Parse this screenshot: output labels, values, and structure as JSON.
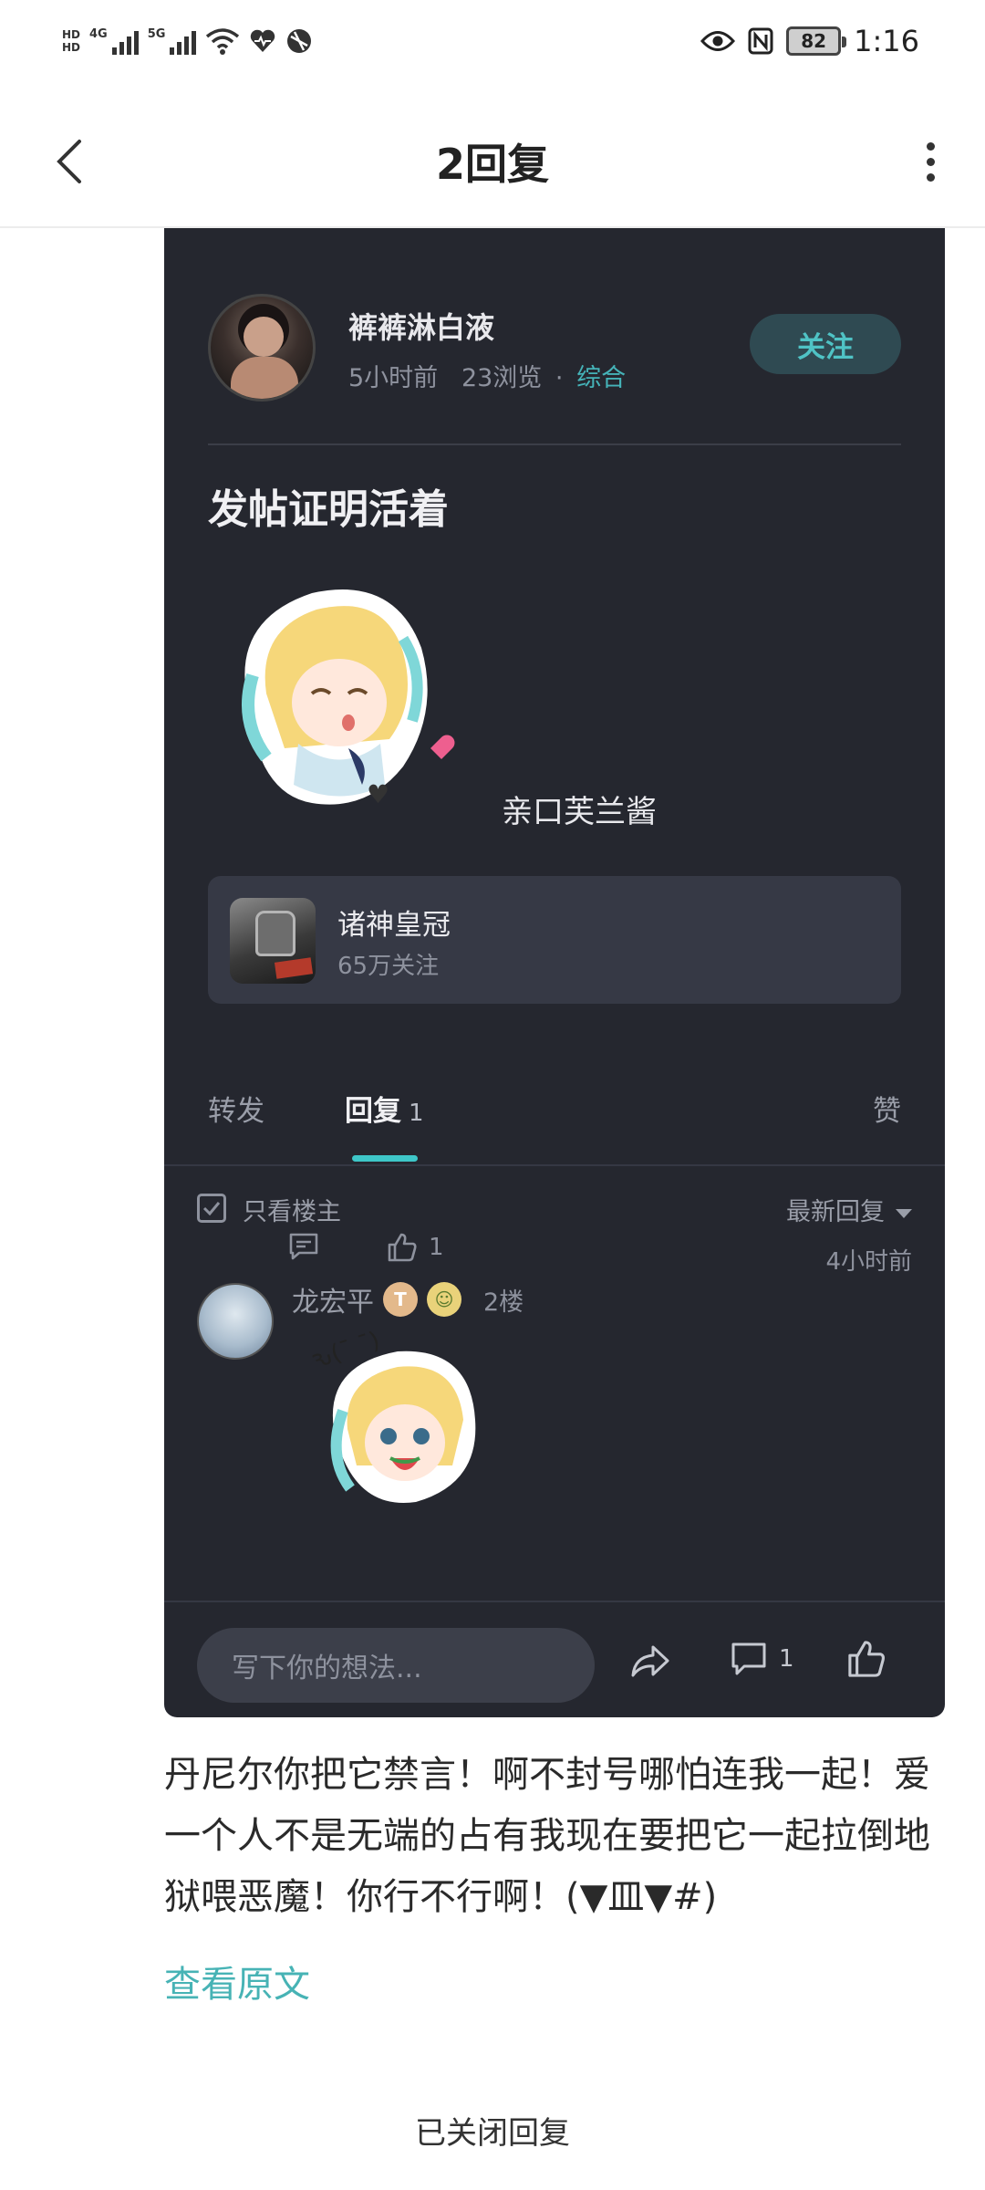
{
  "status_bar": {
    "hd1": "HD",
    "hd2": "HD",
    "net1": "4G",
    "net2": "5G",
    "battery": "82",
    "time": "1:16"
  },
  "header": {
    "title": "2回复"
  },
  "post": {
    "author_name": "裤裤淋白液",
    "time_ago": "5小时前",
    "views": "23浏览",
    "category": "综合",
    "follow_label": "关注",
    "title": "发帖证明活着",
    "sticker_caption": "亲口芙兰酱",
    "game": {
      "name": "诸神皇冠",
      "followers": "65万关注"
    },
    "tabs": {
      "forward": "转发",
      "reply": "回复",
      "reply_count": "1",
      "like": "赞"
    },
    "filter": {
      "only_op": "只看楼主",
      "sort": "最新回复"
    },
    "reply": {
      "name": "龙宏平",
      "badge": "T",
      "floor": "2楼",
      "like_count": "1",
      "time_ago": "4小时前"
    },
    "comment_bar": {
      "placeholder": "写下你的想法...",
      "comment_count": "1"
    }
  },
  "content": {
    "body": "丹尼尔你把它禁言！啊不封号哪怕连我一起！爱一个人不是无端的占有我现在要把它一起拉倒地狱喂恶魔！你行不行啊！(▼皿▼#)",
    "view_original": "查看原文",
    "closed_notice": "已关闭回复"
  },
  "colors": {
    "card_bg": "#25272f",
    "accent": "#3ec6c8",
    "link": "#47b3b5"
  }
}
